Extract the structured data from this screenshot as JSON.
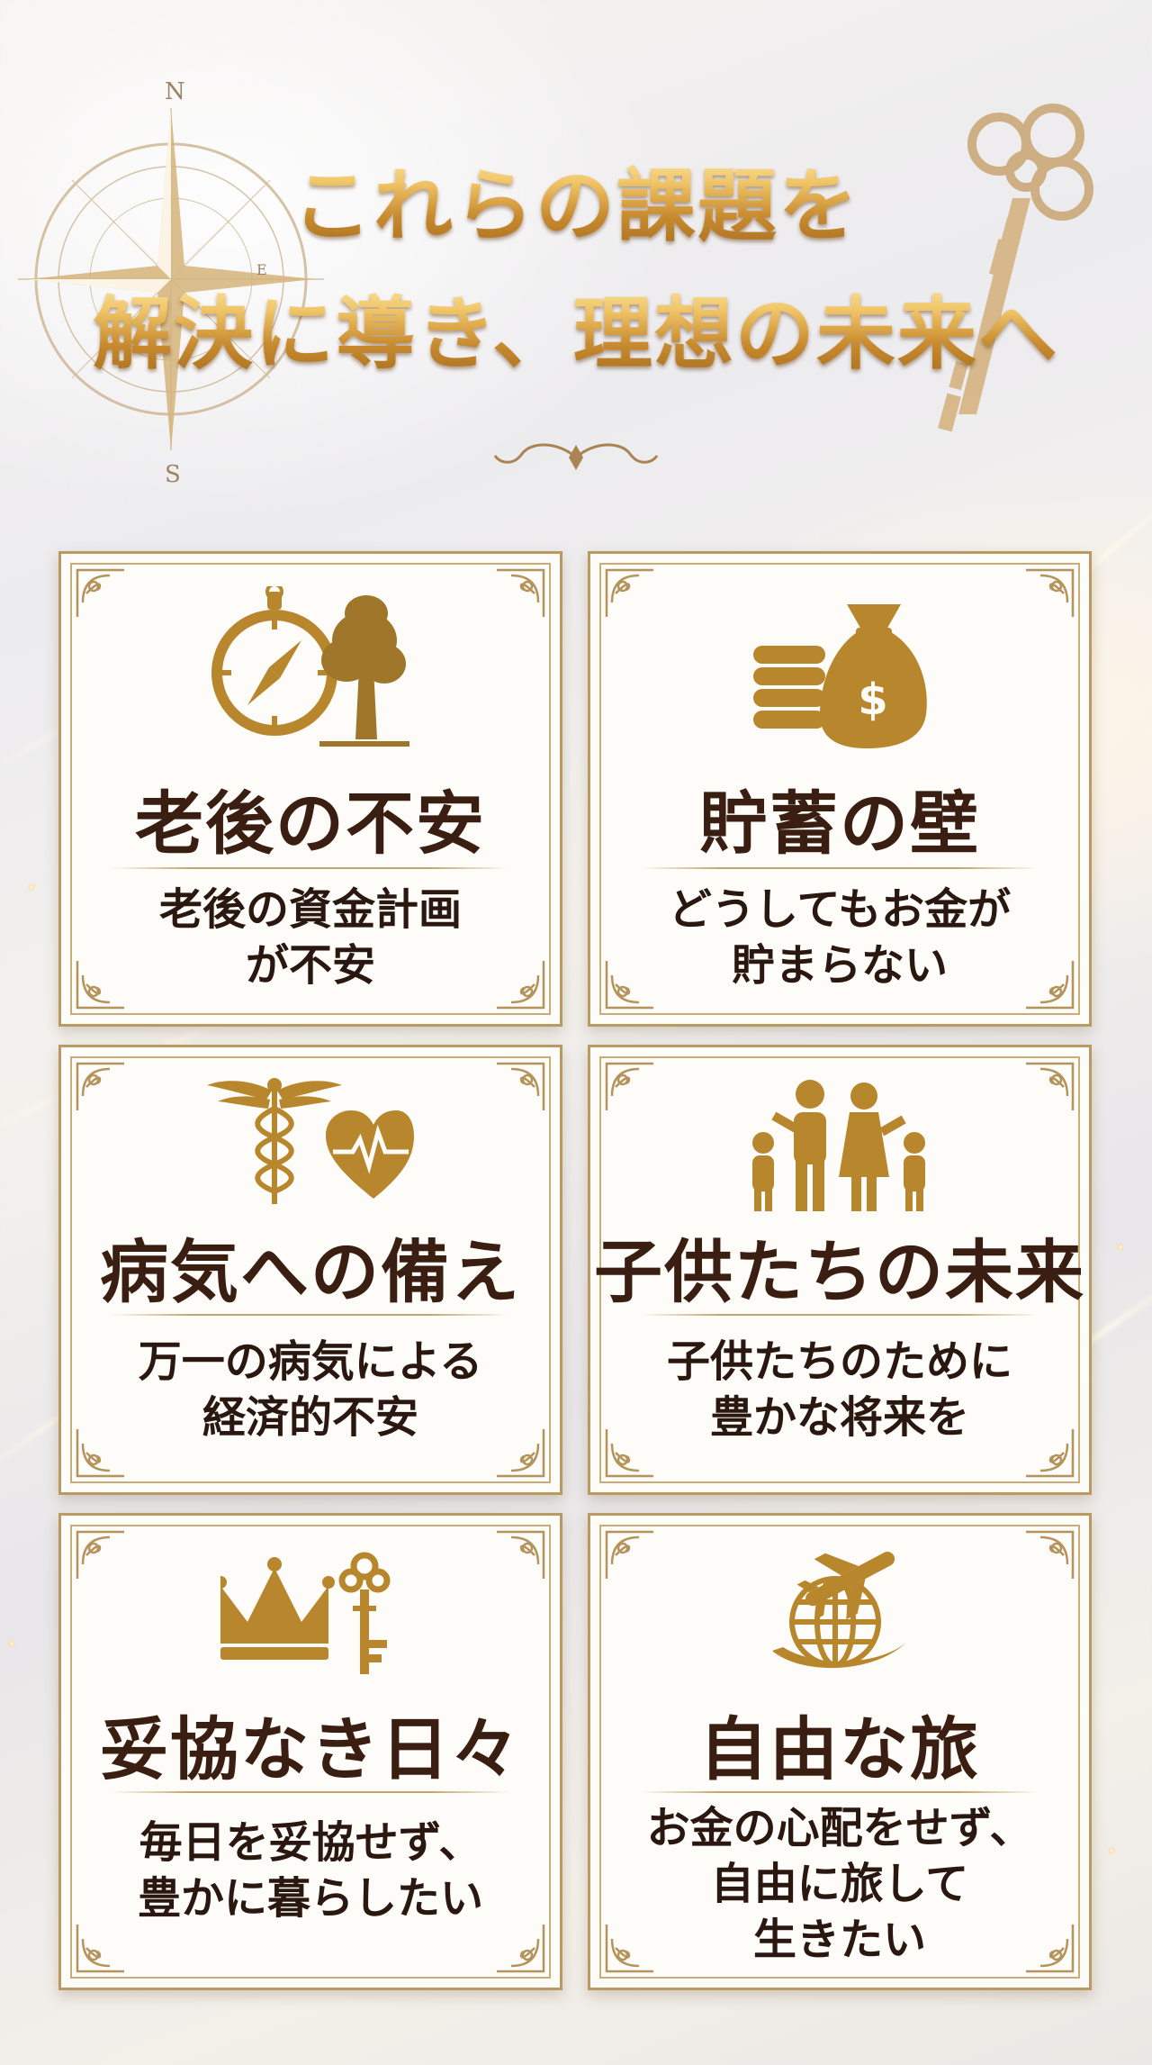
{
  "header": {
    "title_line1": "これらの課題を",
    "title_line2": "解決に導き、理想の未来へ",
    "compass_letters": {
      "north": "N",
      "south": "S",
      "east": "E"
    }
  },
  "colors": {
    "gold": "#c8953a",
    "card_title": "#3b1e12",
    "card_text": "#2a1810",
    "card_border": "#b99a62"
  },
  "cards": [
    {
      "icon": "compass-tree-icon",
      "title": "老後の不安",
      "description": "老後の資金計画\nが不安"
    },
    {
      "icon": "money-bag-coins-icon",
      "title": "貯蓄の壁",
      "description": "どうしてもお金が\n貯まらない"
    },
    {
      "icon": "caduceus-heart-icon",
      "title": "病気への備え",
      "description": "万一の病気による\n経済的不安"
    },
    {
      "icon": "family-icon",
      "title": "子供たちの未来",
      "description": "子供たちのために\n豊かな将来を"
    },
    {
      "icon": "crown-key-icon",
      "title": "妥協なき日々",
      "description": "毎日を妥協せず、\n豊かに暮らしたい"
    },
    {
      "icon": "globe-airplane-icon",
      "title": "自由な旅",
      "description": "お金の心配をせず、\n自由に旅して\n生きたい"
    }
  ]
}
